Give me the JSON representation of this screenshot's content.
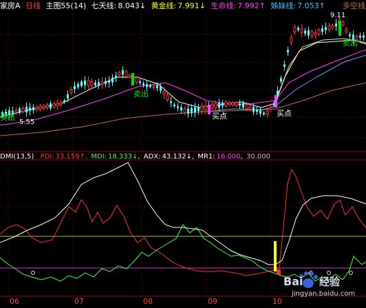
{
  "main_header": {
    "stock_name": "家房A",
    "period": "日线",
    "chart_label": "主图55",
    "params": "(14)",
    "ma7_label": "七天线:",
    "ma7_value": "8.043",
    "golden_label": "黄金线:",
    "golden_value": "7.991",
    "life_label": "生命线:",
    "life_value": "7.992",
    "sister_label": "姊妹线:",
    "sister_value": "7.053",
    "bull_bear": "多空线"
  },
  "price_panel": {
    "peak_label": "9.11",
    "bottom_left_label": "5.55",
    "signals": [
      {
        "text": "卖出",
        "color": "#00e000"
      },
      {
        "text": "买点",
        "color": "#ffffff"
      },
      {
        "text": "买点",
        "color": "#ffffff"
      },
      {
        "text": "卖出",
        "color": "#00e000"
      },
      {
        "text": "卖出",
        "color": "#00e000"
      }
    ]
  },
  "indicator_header": {
    "name": "DMI",
    "params": "(13,5)",
    "pdi_label": "PDI:",
    "pdi_value": "33.159",
    "mdi_label": "MDI:",
    "mdi_value": "18.333",
    "adx_label": "ADX:",
    "adx_value": "43.132",
    "mr1_label": "MR1:",
    "mr1_value": "16.000",
    "extra_value": "30.000"
  },
  "time_axis": {
    "labels": [
      "06",
      "07",
      "08",
      "09",
      "10"
    ]
  },
  "watermark": {
    "brand": "Bai",
    "brand2": "经验",
    "url": "jingyan.baidu.com"
  },
  "colors": {
    "background": "#000000",
    "up_candle": "#ff3232",
    "down_candle": "#54ffff",
    "ma_white": "#ffffff",
    "ma_yellow": "#ffff00",
    "ma_magenta": "#ff40ff",
    "ma_blue": "#6aa0ff",
    "ma_brown": "#c07040",
    "pdi": "#ff3030",
    "mdi": "#40ff40",
    "adx": "#ffffff",
    "level_line": "#c8c840"
  }
}
